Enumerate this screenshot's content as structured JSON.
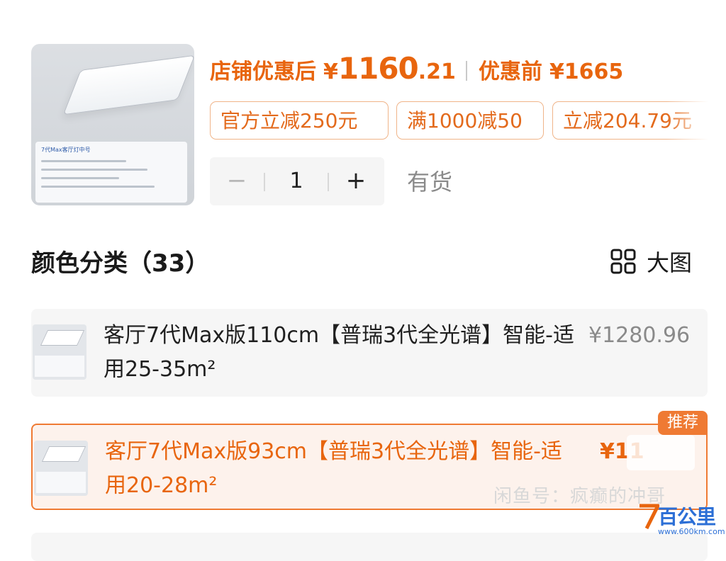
{
  "product": {
    "image_label": "7代Max客厅灯中号",
    "price_label": "店铺优惠后",
    "price_currency": "¥",
    "price_integer": "1160",
    "price_decimal": ".21",
    "original_label": "优惠前",
    "original_price": "¥1665"
  },
  "coupons": [
    "官方立减250元",
    "满1000减50",
    "立减204.79元"
  ],
  "quantity": {
    "minus_label": "−",
    "value": "1",
    "plus_label": "+",
    "stock_status": "有货"
  },
  "section": {
    "title": "颜色分类（33）",
    "big_view_label": "大图",
    "grid_icon": "grid-icon"
  },
  "variants": [
    {
      "name": "客厅7代Max版110cm【普瑞3代全光谱】智能-适用25-35m²",
      "price": "¥1280.96",
      "selected": false
    },
    {
      "name": "客厅7代Max版93cm【普瑞3代全光谱】智能-适用20-28m²",
      "price": "¥11",
      "selected": true,
      "badge": "推荐"
    }
  ],
  "watermark": {
    "text": "闲鱼号：疯癫的冲哥",
    "logo_name": "百公里",
    "logo_url": "www.600km.com"
  },
  "colors": {
    "accent": "#e8650e",
    "chip_border": "#f0b489",
    "selected_bg": "#fdf2ec",
    "muted": "#8a8a8a"
  }
}
